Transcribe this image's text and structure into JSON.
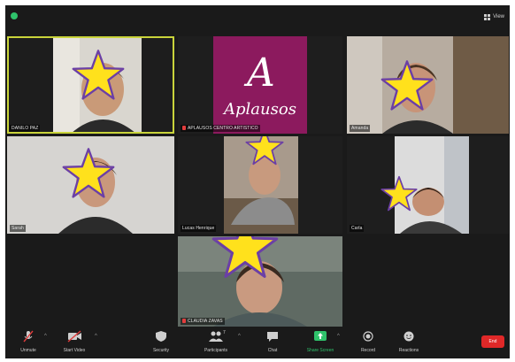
{
  "topbar": {
    "view_label": "View"
  },
  "participants": [
    {
      "name": "DANILO PAZ",
      "active": true
    },
    {
      "name": "APLAUSOS CENTRO ARTISTICO",
      "muted": true,
      "logo_text": "Aplausos",
      "logo_letter": "A"
    },
    {
      "name": "Amanda"
    },
    {
      "name": "Sarah"
    },
    {
      "name": "Lucas Henrique"
    },
    {
      "name": "Carla"
    },
    {
      "name": "CLAUDIA ZAVAS",
      "muted": true
    }
  ],
  "toolbar": {
    "unmute": "Unmute",
    "start_video": "Start Video",
    "security": "Security",
    "participants": "Participants",
    "participants_count": "7",
    "chat": "Chat",
    "share_screen": "Share Screen",
    "record": "Record",
    "reactions": "Reactions",
    "end": "End"
  },
  "colors": {
    "background": "#1a1a1a",
    "active_speaker": "#c9d43b",
    "share_green": "#2fc26b",
    "end_red": "#e02828",
    "mute_red": "#e23d3d",
    "star_fill": "#ffe11c",
    "star_stroke": "#6b3fa6",
    "logo_bg": "#8c1a5e"
  },
  "icons": [
    "shield-icon",
    "grid-view-icon",
    "mic-muted-icon",
    "video-off-icon",
    "security-icon",
    "participants-icon",
    "chat-icon",
    "share-screen-icon",
    "record-icon",
    "reactions-icon",
    "star-icon"
  ]
}
